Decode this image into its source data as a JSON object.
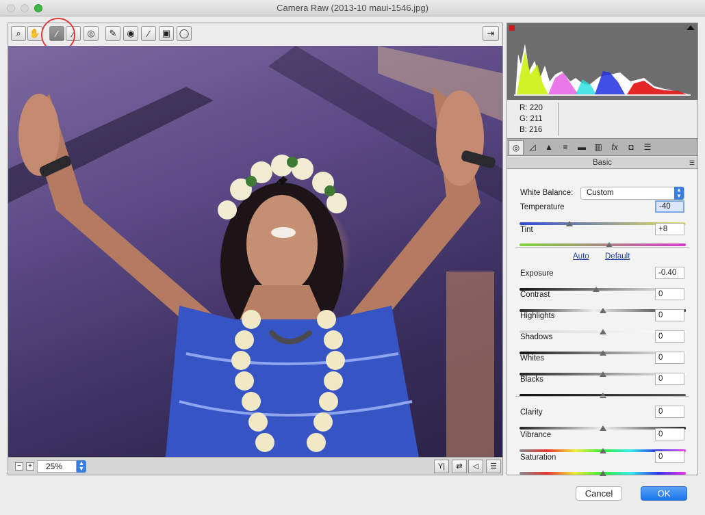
{
  "window": {
    "title": "Camera Raw (2013-10 maui-1546.jpg)"
  },
  "toolbar": {
    "tools": [
      {
        "name": "zoom-tool",
        "glyph": "⌕"
      },
      {
        "name": "hand-tool",
        "glyph": "✋"
      },
      {
        "name": "white-balance-tool",
        "glyph": "⁄"
      },
      {
        "name": "color-sampler-tool",
        "glyph": "⁄"
      },
      {
        "name": "targeted-adjustment-tool",
        "glyph": "◎"
      },
      {
        "name": "spot-removal-tool",
        "glyph": "✎"
      },
      {
        "name": "red-eye-tool",
        "glyph": "◉"
      },
      {
        "name": "adjustment-brush-tool",
        "glyph": "⁄"
      },
      {
        "name": "graduated-filter-tool",
        "glyph": "▣"
      },
      {
        "name": "radial-filter-tool",
        "glyph": "◯"
      }
    ],
    "active_tool": "white-balance-tool",
    "open_preferences_glyph": "⇥"
  },
  "bottom_bar": {
    "zoom_value": "25%",
    "zoom_out_glyph": "−",
    "zoom_in_glyph": "+",
    "view_buttons": [
      "Y|",
      "⇄",
      "◁",
      "☰"
    ]
  },
  "histogram": {
    "readout": {
      "r": "R:  220",
      "g": "G:  211",
      "b": "B:  216"
    },
    "colors": {
      "red": "#e01010",
      "green": "#c8f000",
      "blue": "#2030e0",
      "magenta": "#e040e0",
      "cyan": "#20e0e0",
      "white": "#ffffff"
    }
  },
  "panel_tabs": [
    {
      "name": "tab-basic",
      "glyph": "◎"
    },
    {
      "name": "tab-tone-curve",
      "glyph": "◿"
    },
    {
      "name": "tab-detail",
      "glyph": "▲"
    },
    {
      "name": "tab-hsl",
      "glyph": "≡"
    },
    {
      "name": "tab-split-toning",
      "glyph": "▬"
    },
    {
      "name": "tab-lens-corrections",
      "glyph": "▥"
    },
    {
      "name": "tab-effects",
      "glyph": "fx"
    },
    {
      "name": "tab-camera-calibration",
      "glyph": "◘"
    },
    {
      "name": "tab-presets",
      "glyph": "☰"
    }
  ],
  "panel": {
    "title": "Basic",
    "white_balance_label": "White Balance:",
    "white_balance_value": "Custom",
    "auto_link": "Auto",
    "default_link": "Default",
    "sliders": [
      {
        "key": "temperature",
        "label": "Temperature",
        "value": "-40",
        "position": 0.3
      },
      {
        "key": "tint",
        "label": "Tint",
        "value": "+8",
        "position": 0.54
      },
      {
        "key": "exposure",
        "label": "Exposure",
        "value": "-0.40",
        "position": 0.46
      },
      {
        "key": "contrast",
        "label": "Contrast",
        "value": "0",
        "position": 0.5
      },
      {
        "key": "highlights",
        "label": "Highlights",
        "value": "0",
        "position": 0.5
      },
      {
        "key": "shadows",
        "label": "Shadows",
        "value": "0",
        "position": 0.5
      },
      {
        "key": "whites",
        "label": "Whites",
        "value": "0",
        "position": 0.5
      },
      {
        "key": "blacks",
        "label": "Blacks",
        "value": "0",
        "position": 0.5
      },
      {
        "key": "clarity",
        "label": "Clarity",
        "value": "0",
        "position": 0.5
      },
      {
        "key": "vibrance",
        "label": "Vibrance",
        "value": "0",
        "position": 0.5
      },
      {
        "key": "saturation",
        "label": "Saturation",
        "value": "0",
        "position": 0.5
      }
    ]
  },
  "buttons": {
    "cancel": "Cancel",
    "ok": "OK"
  }
}
